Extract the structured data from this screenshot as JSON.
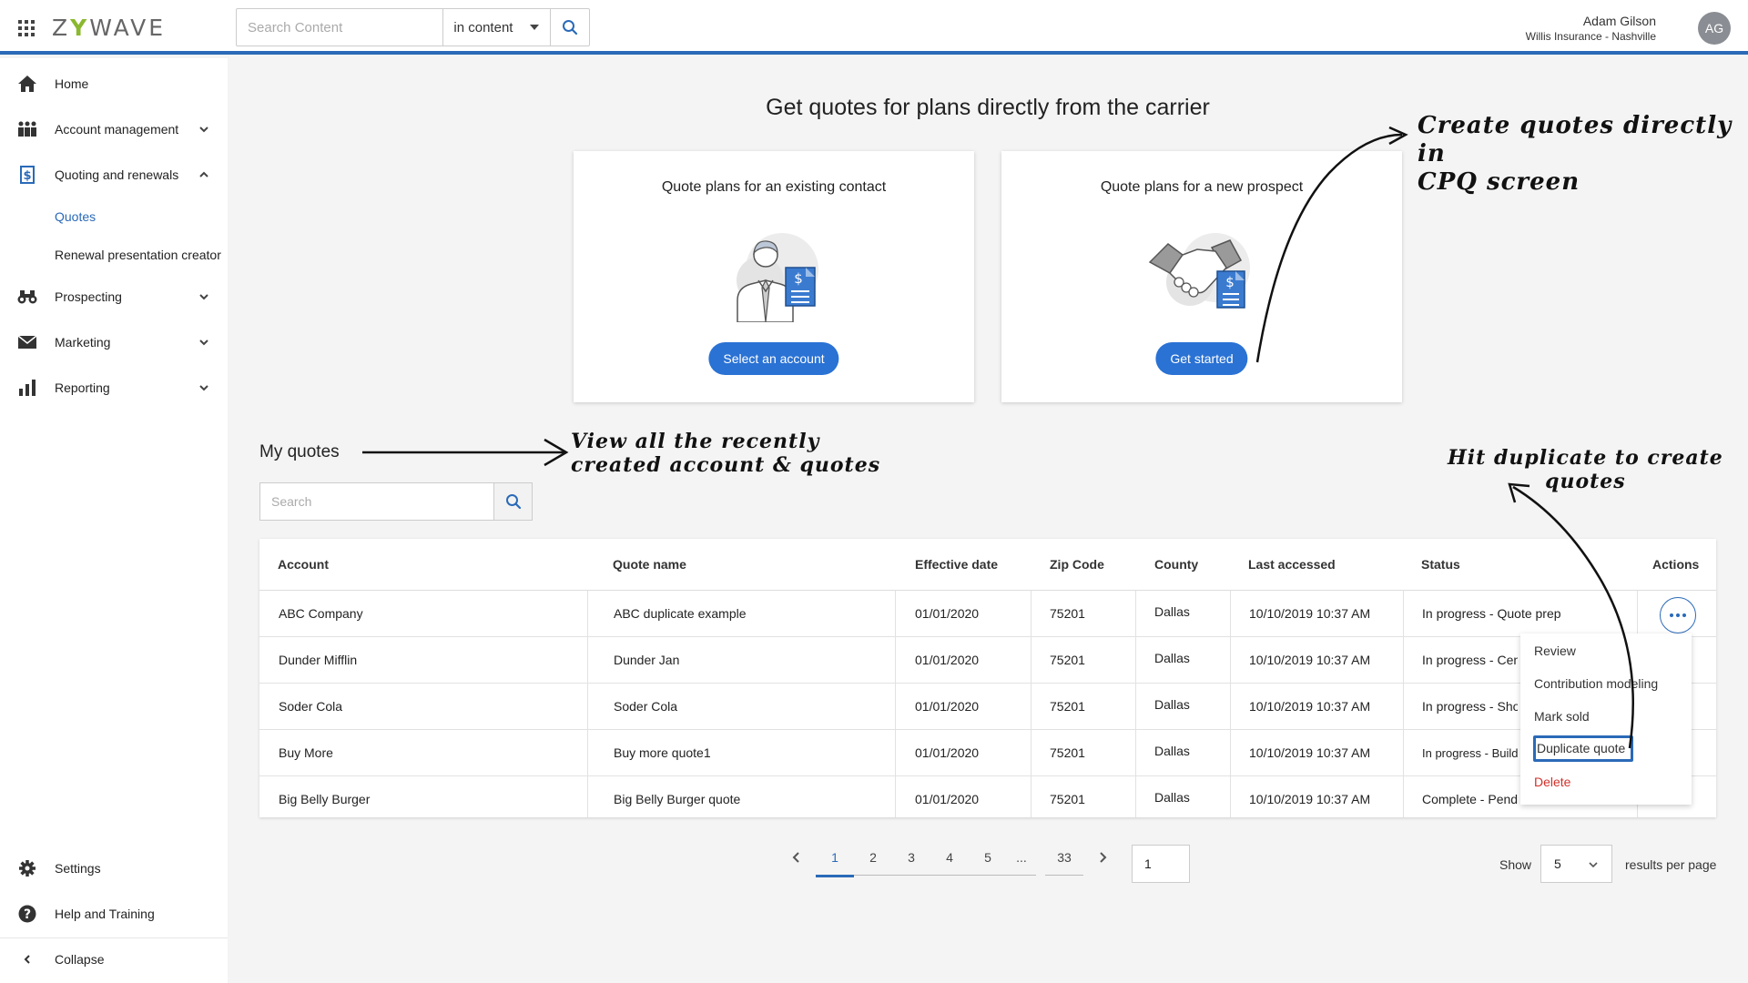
{
  "header": {
    "logo_text": "ZYWAVE",
    "search_placeholder": "Search Content",
    "search_scope": "in content",
    "user_name": "Adam Gilson",
    "user_org": "Willis Insurance - Nashville",
    "avatar_initials": "AG"
  },
  "sidebar": {
    "home": "Home",
    "account_management": "Account management",
    "quoting": "Quoting and renewals",
    "quotes": "Quotes",
    "renewal": "Renewal presentation creator",
    "prospecting": "Prospecting",
    "marketing": "Marketing",
    "reporting": "Reporting",
    "settings": "Settings",
    "help": "Help and Training",
    "collapse": "Collapse"
  },
  "main": {
    "title": "Get quotes for plans directly from the carrier",
    "cards": [
      {
        "title": "Quote plans for an existing contact",
        "button": "Select an account"
      },
      {
        "title": "Quote plans for a new prospect",
        "button": "Get started"
      }
    ]
  },
  "quotes": {
    "section_title": "My quotes",
    "search_placeholder": "Search",
    "columns": [
      "Account",
      "Quote name",
      "Effective date",
      "Zip Code",
      "County",
      "Last accessed",
      "Status",
      "Actions"
    ],
    "rows": [
      [
        "ABC Company",
        "ABC duplicate example",
        "01/01/2020",
        "75201",
        "Dallas",
        "10/10/2019 10:37 AM",
        "In progress - Quote prep"
      ],
      [
        "Dunder Mifflin",
        "Dunder Jan",
        "01/01/2020",
        "75201",
        "Dallas",
        "10/10/2019 10:37 AM",
        "In progress - Cen"
      ],
      [
        "Soder Cola",
        "Soder Cola",
        "01/01/2020",
        "75201",
        "Dallas",
        "10/10/2019 10:37 AM",
        "In progress - Sho"
      ],
      [
        "Buy More",
        "Buy more quote1",
        "01/01/2020",
        "75201",
        "Dallas",
        "10/10/2019 10:37 AM",
        "In progress - Buildi"
      ],
      [
        "Big Belly Burger",
        "Big Belly Burger quote",
        "01/01/2020",
        "75201",
        "Dallas",
        "10/10/2019 10:37 AM",
        "Complete - Pendi"
      ]
    ],
    "menu": [
      "Review",
      "Contribution modeling",
      "Mark sold",
      "Duplicate quote",
      "Delete"
    ]
  },
  "pagination": {
    "pages": [
      "1",
      "2",
      "3",
      "4",
      "5"
    ],
    "ellipsis": "...",
    "last": "33",
    "current_input": "1",
    "show_label": "Show",
    "per_page_value": "5",
    "per_page_label": "results per page"
  },
  "annotations": {
    "top_right_line1": "Create quotes directly in",
    "top_right_line2": "CPQ screen",
    "middle_line1": "View all the recently",
    "middle_line2": "created account & quotes",
    "right_line1": "Hit duplicate to create",
    "right_line2": "quotes"
  },
  "colors": {
    "brand_blue": "#2a6ab8",
    "button_blue": "#2a72d4",
    "delete_red": "#d0322b",
    "logo_green": "#8ab82f"
  }
}
